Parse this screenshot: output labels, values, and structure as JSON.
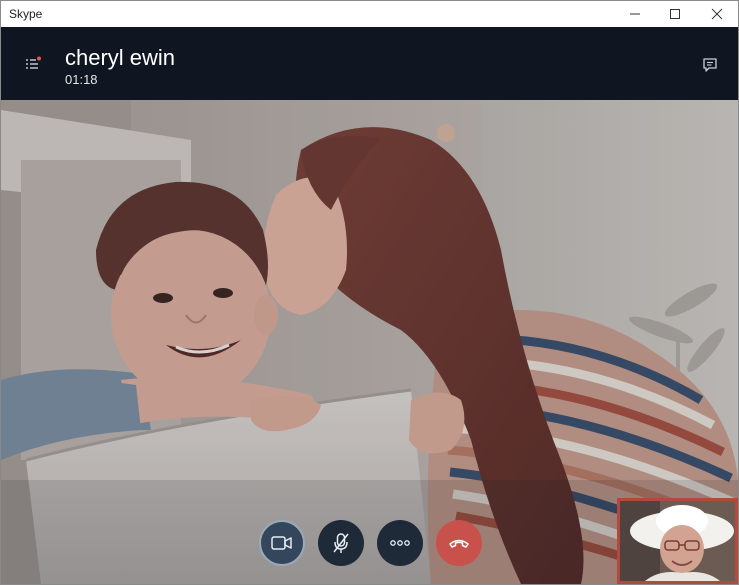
{
  "window": {
    "title": "Skype"
  },
  "call": {
    "contact_name": "cheryl ewin",
    "duration": "01:18"
  },
  "icons": {
    "participants": "participants-list-icon",
    "chat": "chat-icon",
    "video": "video-camera-icon",
    "mic": "microphone-muted-icon",
    "more": "more-options-icon",
    "end_call": "end-call-icon",
    "minimize": "minimize-icon",
    "maximize": "maximize-icon",
    "close": "close-icon"
  },
  "colors": {
    "header_bg": "#0f1622",
    "end_call": "#c8524b",
    "self_view_border": "#b4473e",
    "video_active": "#34465c"
  }
}
